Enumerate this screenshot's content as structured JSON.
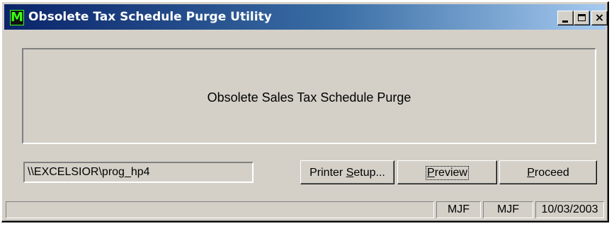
{
  "window": {
    "title": "Obsolete Tax Schedule Purge Utility",
    "app_icon_letter": "M",
    "caption_buttons": {
      "minimize": "_",
      "maximize": "□",
      "close": "×"
    }
  },
  "panel": {
    "title": "Obsolete Sales Tax Schedule Purge"
  },
  "printer": {
    "path": "\\\\EXCELSIOR\\prog_hp4"
  },
  "buttons": {
    "printer_setup": {
      "before": "Printer ",
      "accel": "S",
      "after": "etup..."
    },
    "preview": {
      "before": "",
      "accel": "P",
      "after": "review"
    },
    "proceed": {
      "before": "",
      "accel": "P",
      "after": "roceed"
    }
  },
  "statusbar": {
    "message": "",
    "user1": "MJF",
    "user2": "MJF",
    "date": "10/03/2003"
  },
  "colors": {
    "titlebar_start": "#0a246a",
    "titlebar_end": "#a6caf0",
    "face": "#d4d0c8"
  }
}
